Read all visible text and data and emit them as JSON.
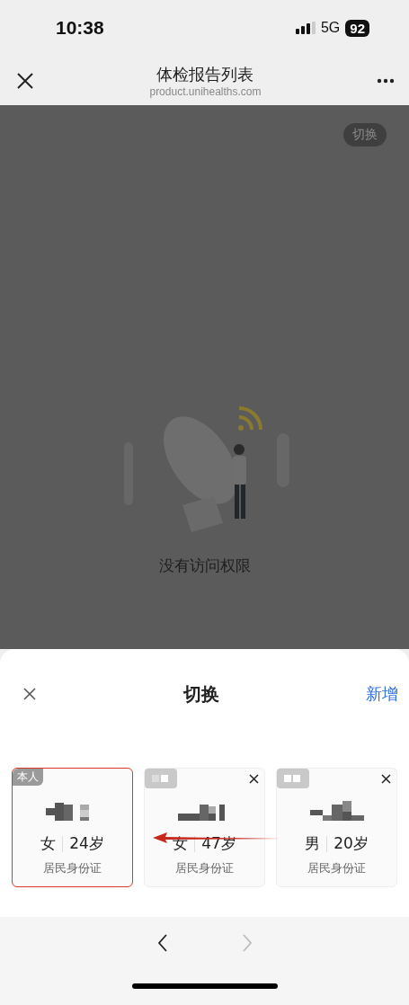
{
  "status_bar": {
    "time": "10:38",
    "network": "5G",
    "battery": "92"
  },
  "nav_bar": {
    "title": "体检报告列表",
    "url": "product.unihealths.com"
  },
  "page": {
    "switch_button": "切换",
    "empty_message": "没有访问权限"
  },
  "sheet": {
    "title": "切换",
    "add_button": "新增",
    "members": [
      {
        "tag": "本人",
        "gender": "女",
        "age": "24岁",
        "id_type": "居民身份证",
        "removable": false,
        "highlighted": true
      },
      {
        "gender": "女",
        "age": "47岁",
        "id_type": "居民身份证",
        "removable": true,
        "highlighted": false
      },
      {
        "gender": "男",
        "age": "20岁",
        "id_type": "居民身份证",
        "removable": true,
        "highlighted": false
      }
    ],
    "pager": {
      "prev_disabled": false,
      "next_disabled": true
    }
  }
}
